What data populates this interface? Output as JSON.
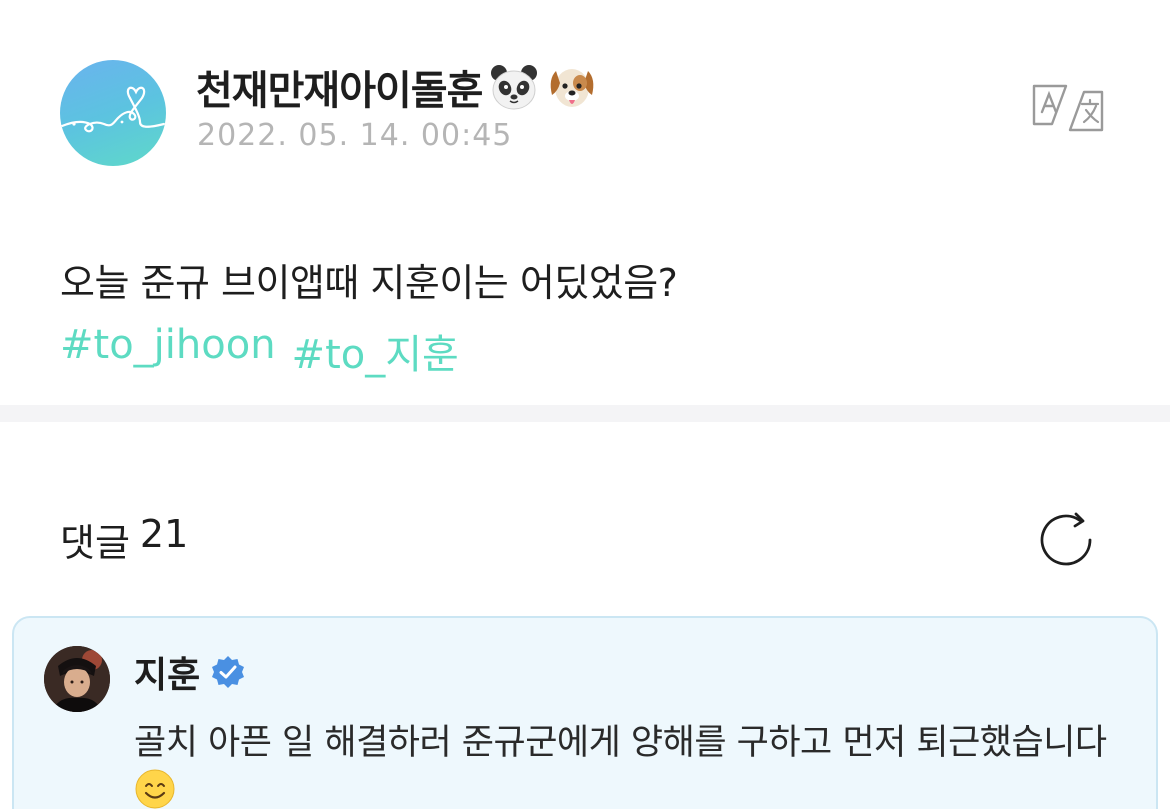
{
  "post": {
    "author": "천재만재아이돌훈",
    "author_emojis": [
      "panda-face-icon",
      "dog-face-icon"
    ],
    "date": "2022. 05. 14. 00:45",
    "body": "오늘 준규 브이앱때 지훈이는 어딨었음?",
    "hashtags": [
      "#to_jihoon",
      "#to_지훈"
    ],
    "translate_icon": "translate-icon"
  },
  "comments_header": {
    "label": "댓글",
    "count": "21",
    "refresh_icon": "refresh-icon"
  },
  "comment": {
    "author": "지훈",
    "verified_icon": "verified-badge-icon",
    "text": "골치 아픈 일 해결하러 준규군에게 양해를 구하고 먼저 퇴근했습니다",
    "trailing_emoji": "smiling-face-icon"
  },
  "colors": {
    "hashtag": "#5ddbc2",
    "date": "#b5b5b5",
    "comment_bg": "#eef8fd",
    "comment_border": "#cbe6f3",
    "verified": "#4a90e2",
    "divider": "#f4f4f6"
  }
}
